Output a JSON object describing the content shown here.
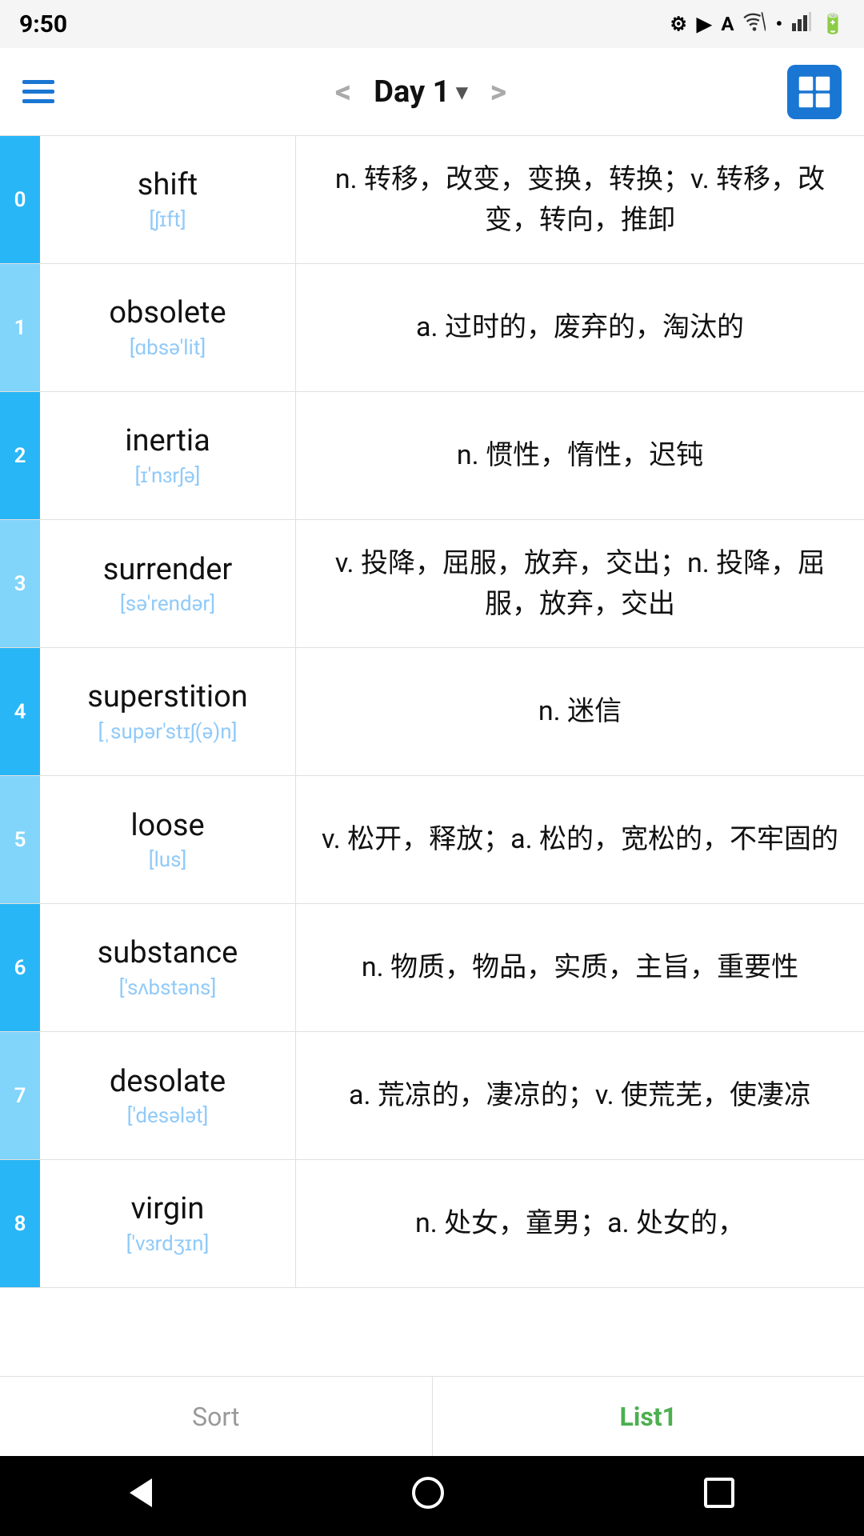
{
  "statusBar": {
    "time": "9:50",
    "icons": [
      "gear",
      "play-protect",
      "font",
      "wifi",
      "dot",
      "signal",
      "battery"
    ]
  },
  "appBar": {
    "prevLabel": "<",
    "nextLabel": ">",
    "title": "Day 1",
    "dropdownIcon": "▾"
  },
  "words": [
    {
      "index": "0",
      "word": "shift",
      "phonetic": "[ʃɪft]",
      "definition": "n. 转移，改变，变换，转换；v. 转移，改变，转向，推卸"
    },
    {
      "index": "1",
      "word": "obsolete",
      "phonetic": "[ɑbsə'lit]",
      "definition": "a. 过时的，废弃的，淘汰的"
    },
    {
      "index": "2",
      "word": "inertia",
      "phonetic": "[ɪ'nɜrʃə]",
      "definition": "n. 惯性，惰性，迟钝"
    },
    {
      "index": "3",
      "word": "surrender",
      "phonetic": "[sə'rendər]",
      "definition": "v. 投降，屈服，放弃，交出；n. 投降，屈服，放弃，交出"
    },
    {
      "index": "4",
      "word": "superstition",
      "phonetic": "[ˌsupər'stɪʃ(ə)n]",
      "definition": "n. 迷信"
    },
    {
      "index": "5",
      "word": "loose",
      "phonetic": "[lus]",
      "definition": "v. 松开，释放；a. 松的，宽松的，不牢固的"
    },
    {
      "index": "6",
      "word": "substance",
      "phonetic": "['sʌbstəns]",
      "definition": "n. 物质，物品，实质，主旨，重要性"
    },
    {
      "index": "7",
      "word": "desolate",
      "phonetic": "['desələt]",
      "definition": "a. 荒凉的，凄凉的；v. 使荒芜，使凄凉"
    },
    {
      "index": "8",
      "word": "virgin",
      "phonetic": "['vɜrdʒɪn]",
      "definition": "n. 处女，童男；a. 处女的，"
    }
  ],
  "bottomTabs": [
    {
      "label": "Sort",
      "active": false
    },
    {
      "label": "List1",
      "active": true
    }
  ],
  "navBar": {
    "back": "back",
    "home": "home",
    "recent": "recent"
  }
}
